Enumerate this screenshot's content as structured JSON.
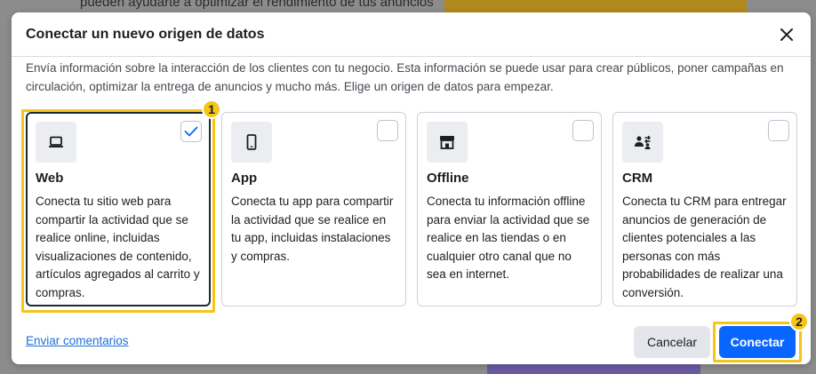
{
  "background": {
    "text": "pueden ayudarte a optimizar el rendimiento de tus anuncios"
  },
  "dialog": {
    "title": "Conectar un nuevo origen de datos",
    "description": "Envía información sobre la interacción de los clientes con tu negocio. Esta información se puede usar para crear públicos, poner campañas en circulación, optimizar la entrega de anuncios y mucho más. Elige un origen de datos para empezar.",
    "cards": [
      {
        "title": "Web",
        "description": "Conecta tu sitio web para compartir la actividad que se realice online, incluidas visualizaciones de contenido, artículos agregados al carrito y compras.",
        "icon": "laptop-icon",
        "selected": true
      },
      {
        "title": "App",
        "description": "Conecta tu app para compartir la actividad que se realice en tu app, incluidas instalaciones y compras.",
        "icon": "phone-icon",
        "selected": false
      },
      {
        "title": "Offline",
        "description": "Conecta tu información offline para enviar la actividad que se realice en las tiendas o en cualquier otro canal que no sea en internet.",
        "icon": "store-icon",
        "selected": false
      },
      {
        "title": "CRM",
        "description": "Conecta tu CRM para entregar anuncios de generación de clientes potenciales a las personas con más probabilidades de realizar una conversión.",
        "icon": "people-exchange-icon",
        "selected": false
      }
    ],
    "feedback_link": "Enviar comentarios",
    "cancel_label": "Cancelar",
    "connect_label": "Conectar"
  },
  "annotations": {
    "badge_1": "1",
    "badge_2": "2"
  },
  "colors": {
    "accent": "#0866ff",
    "highlight": "#f5c518",
    "link": "#216fdb"
  }
}
